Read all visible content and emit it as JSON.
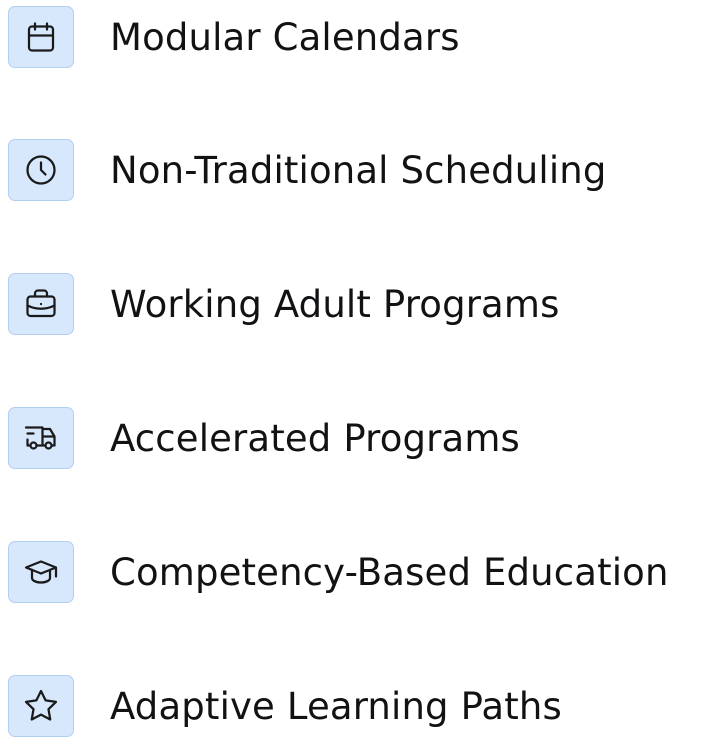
{
  "features": [
    {
      "label": "Modular Calendars",
      "icon": "calendar-icon"
    },
    {
      "label": "Non-Traditional Scheduling",
      "icon": "clock-icon"
    },
    {
      "label": "Working Adult Programs",
      "icon": "briefcase-icon"
    },
    {
      "label": "Accelerated Programs",
      "icon": "fast-truck-icon"
    },
    {
      "label": "Competency-Based Education",
      "icon": "graduation-cap-icon"
    },
    {
      "label": "Adaptive Learning Paths",
      "icon": "star-icon"
    }
  ],
  "colors": {
    "icon_background": "#d7e8fc",
    "icon_border": "#b3cfee",
    "icon_stroke": "#1a1a1a",
    "text": "#101214"
  }
}
